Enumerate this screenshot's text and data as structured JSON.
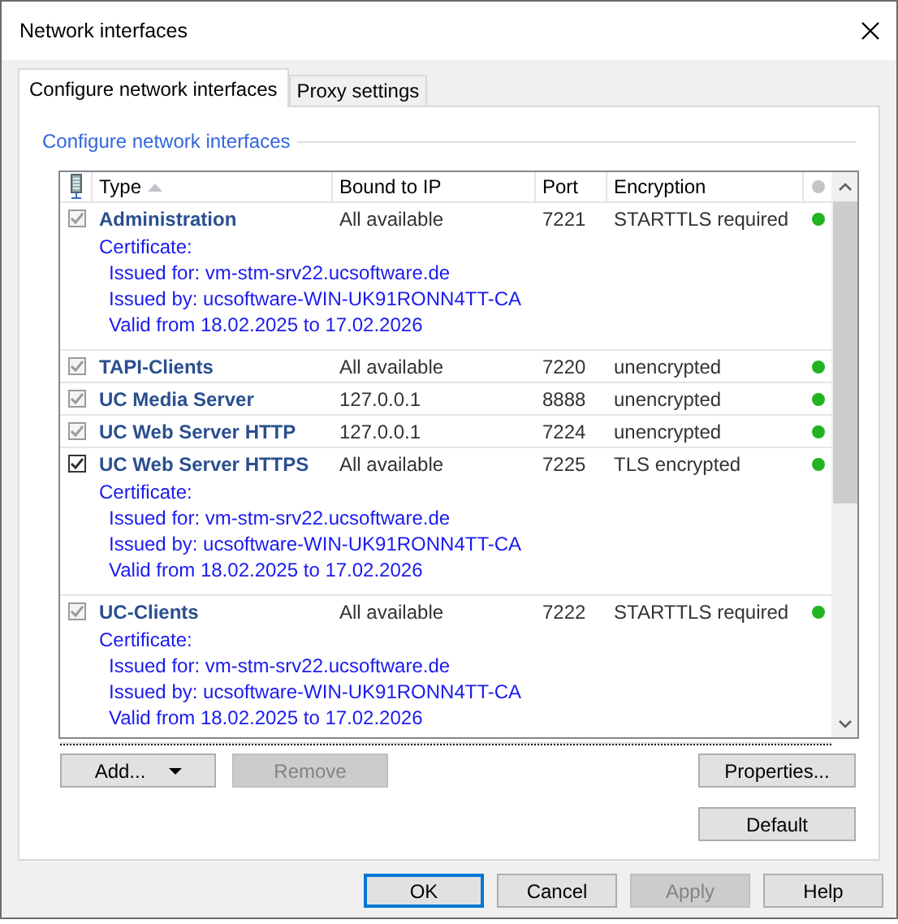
{
  "window": {
    "title": "Network interfaces"
  },
  "tabs": [
    {
      "label": "Configure network interfaces",
      "selected": true
    },
    {
      "label": "Proxy settings",
      "selected": false
    }
  ],
  "group": {
    "title": "Configure network interfaces"
  },
  "table": {
    "columns": [
      {
        "label": "Type",
        "sorted": true
      },
      {
        "label": "Bound to IP",
        "sorted": false
      },
      {
        "label": "Port",
        "sorted": false
      },
      {
        "label": "Encryption",
        "sorted": false
      }
    ],
    "rows": [
      {
        "checked": true,
        "disabled": true,
        "type": "Administration",
        "ip": "All available",
        "port": "7221",
        "encryption": "STARTTLS required",
        "color": "#22b322",
        "certificate": [
          "Certificate:",
          "Issued for: vm-stm-srv22.ucsoftware.de",
          "Issued by: ucsoftware-WIN-UK91RONN4TT-CA",
          "Valid from 18.02.2025 to 17.02.2026"
        ]
      },
      {
        "checked": true,
        "disabled": true,
        "type": "TAPI-Clients",
        "ip": "All available",
        "port": "7220",
        "encryption": "unencrypted",
        "color": "#22b322"
      },
      {
        "checked": true,
        "disabled": true,
        "type": "UC Media Server",
        "ip": "127.0.0.1",
        "port": "8888",
        "encryption": "unencrypted",
        "color": "#22b322"
      },
      {
        "checked": true,
        "disabled": true,
        "type": "UC Web Server HTTP",
        "ip": "127.0.0.1",
        "port": "7224",
        "encryption": "unencrypted",
        "color": "#22b322"
      },
      {
        "checked": true,
        "disabled": false,
        "type": "UC Web Server HTTPS",
        "ip": "All available",
        "port": "7225",
        "encryption": "TLS encrypted",
        "color": "#22b322",
        "certificate": [
          "Certificate:",
          "Issued for: vm-stm-srv22.ucsoftware.de",
          "Issued by: ucsoftware-WIN-UK91RONN4TT-CA",
          "Valid from 18.02.2025 to 17.02.2026"
        ]
      },
      {
        "checked": true,
        "disabled": true,
        "type": "UC-Clients",
        "ip": "All available",
        "port": "7222",
        "encryption": "STARTTLS required",
        "color": "#22b322",
        "certificate": [
          "Certificate:",
          "Issued for: vm-stm-srv22.ucsoftware.de",
          "Issued by: ucsoftware-WIN-UK91RONN4TT-CA",
          "Valid from 18.02.2025 to 17.02.2026"
        ]
      }
    ]
  },
  "list_buttons": [
    {
      "label": "Add...",
      "disabled": false,
      "kind": "dropdown"
    },
    {
      "label": "Remove",
      "disabled": true,
      "kind": "plain"
    }
  ],
  "side_buttons": [
    {
      "label": "Properties...",
      "disabled": false
    },
    {
      "label": "Default",
      "disabled": false
    }
  ],
  "dialog_buttons": [
    {
      "label": "OK",
      "disabled": false,
      "default": true
    },
    {
      "label": "Cancel",
      "disabled": false,
      "default": false
    },
    {
      "label": "Apply",
      "disabled": true,
      "default": false
    },
    {
      "label": "Help",
      "disabled": false,
      "default": false
    }
  ]
}
